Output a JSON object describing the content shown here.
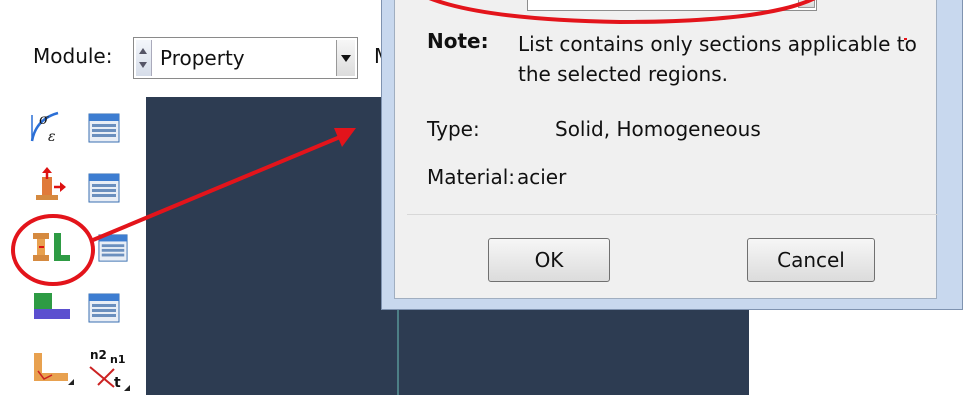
{
  "toolbar": {
    "module_label": "Module:",
    "module_value": "Property",
    "next_label_fragment": "M"
  },
  "toolbox": {
    "icons": [
      "stress-strain-icon",
      "material-manager-icon",
      "create-section-icon",
      "section-manager-icon",
      "assign-section-icon",
      "section-assignment-manager-icon",
      "create-profile-icon",
      "profile-manager-icon",
      "assign-beam-orientation-icon",
      "assign-beam-normal-icon"
    ]
  },
  "dialog": {
    "note_label": "Note:",
    "note_text": "List contains only sections applicable to the selected regions.",
    "type_label": "Type:",
    "type_value": "Solid, Homogeneous",
    "material_label": "Material:",
    "material_value": "acier",
    "ok_label": "OK",
    "cancel_label": "Cancel"
  },
  "colors": {
    "viewport_bg": "#2d3c52",
    "annotation_red": "#e3141b",
    "dialog_frame": "#c8d8ee"
  },
  "icon_glyphs": {
    "stress_top": "σ",
    "stress_bottom": "ε",
    "normal_top": "n2",
    "normal_mid": "n1",
    "normal_t": "t"
  }
}
